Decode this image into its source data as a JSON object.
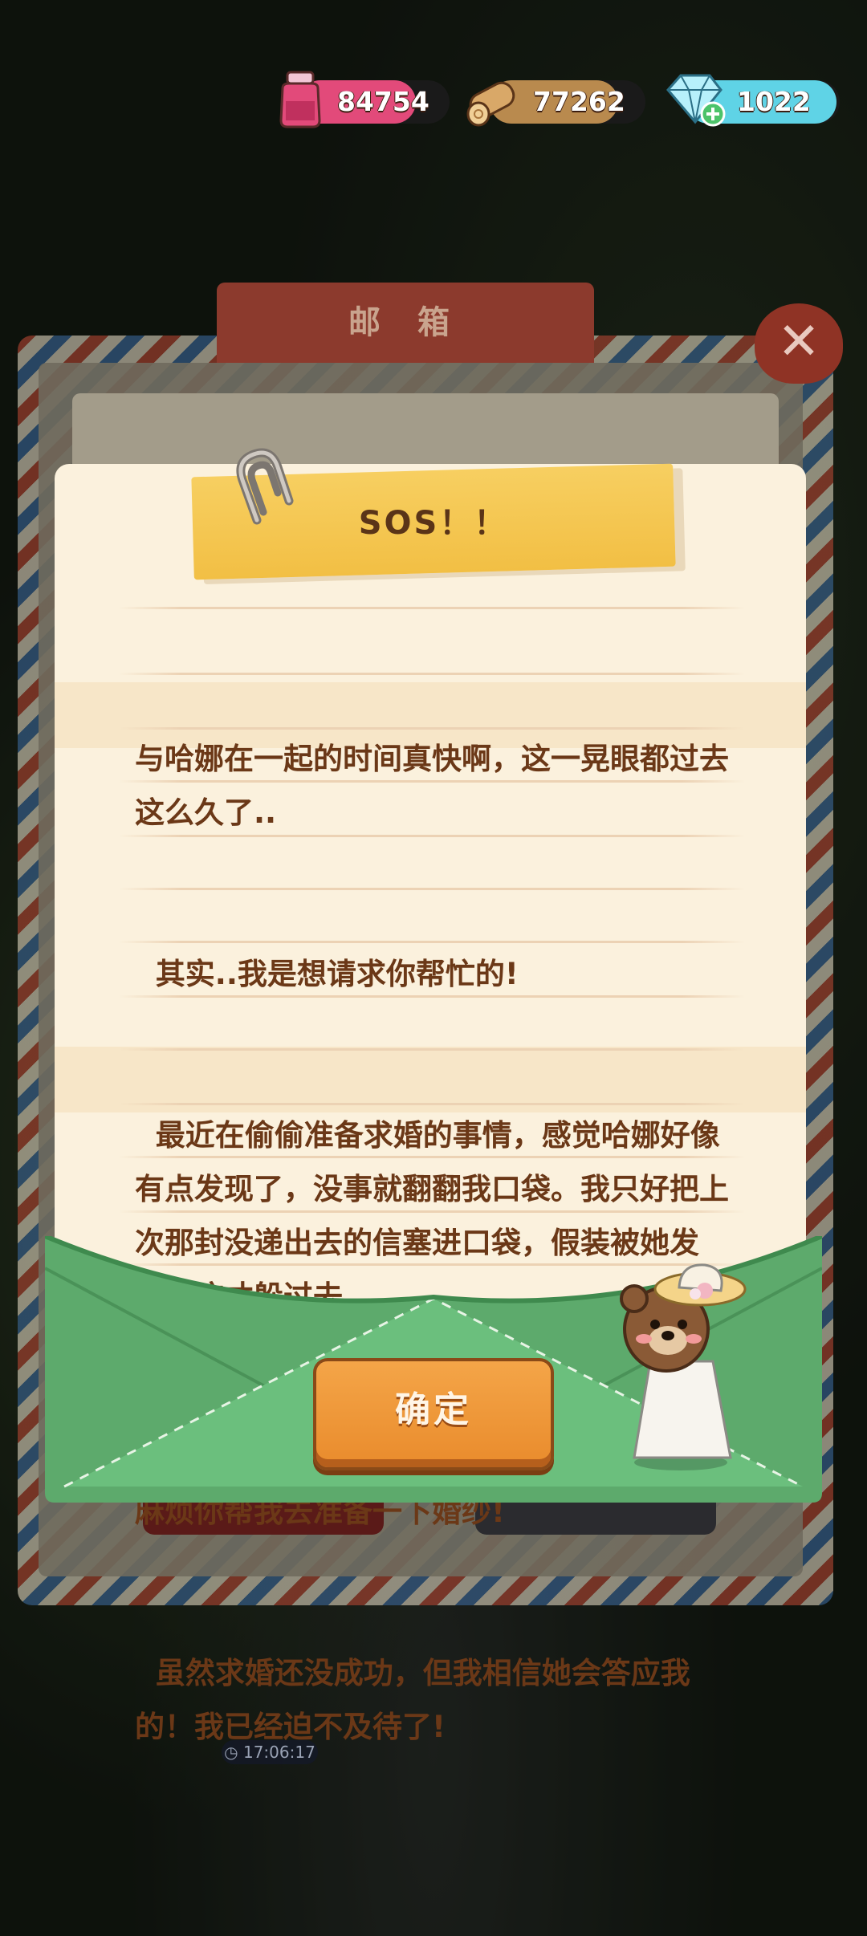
{
  "currencies": [
    {
      "id": "ink",
      "icon": "ink-jar-icon",
      "value": "84754",
      "color": "#e24a7a"
    },
    {
      "id": "wood",
      "icon": "wood-log-icon",
      "value": "77262",
      "color": "#b98a4e"
    },
    {
      "id": "gem",
      "icon": "diamond-icon",
      "value": "1022",
      "color": "#5fd3e6"
    }
  ],
  "mailbox": {
    "title": "邮 箱",
    "close_label": "✕",
    "timer": "17:06:17"
  },
  "letter": {
    "title": "SOS！！",
    "paragraphs": [
      "与哈娜在一起的时间真快啊，这一晃眼都过去这么久了..",
      "  其实..我是想请求你帮忙的!",
      "  最近在偷偷准备求婚的事情，感觉哈娜好像有点发现了，没事就翻翻我口袋。我只好把上次那封没递出去的信塞进口袋，假装被她发现，这才躲过去。",
      "  所以我最近不敢太明显的做准备了，可能要麻烦你帮我去准备一下婚纱!",
      "  虽然求婚还没成功，但我相信她会答应我的！我已经迫不及待了!"
    ],
    "confirm_label": "确定"
  },
  "colors": {
    "letter_bg": "#fbf1dd",
    "tape": "#f2bf44",
    "text": "#6b3817",
    "envelope": "#6bbf7d",
    "button": "#e98b2c"
  }
}
